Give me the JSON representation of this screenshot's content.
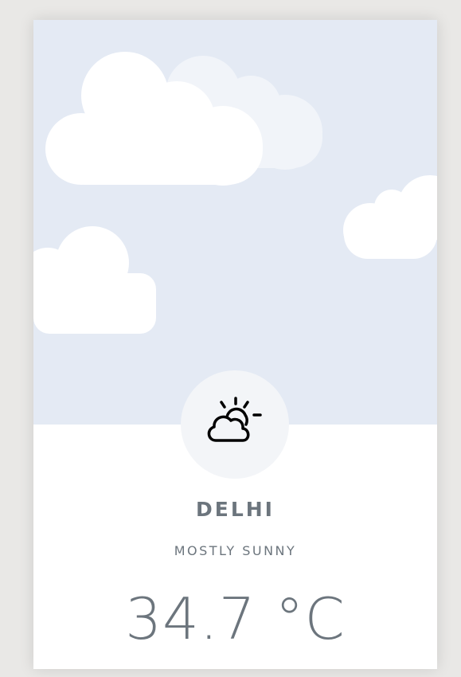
{
  "weather": {
    "city": "DELHI",
    "condition": "MOSTLY SUNNY",
    "temperature": "34.7 °C",
    "icon": "partly-cloudy-sun-icon"
  },
  "colors": {
    "sky": "#e4eaf4",
    "cloud": "#ffffff",
    "text": "#6c757d",
    "icon_bg": "#f3f5f8"
  }
}
